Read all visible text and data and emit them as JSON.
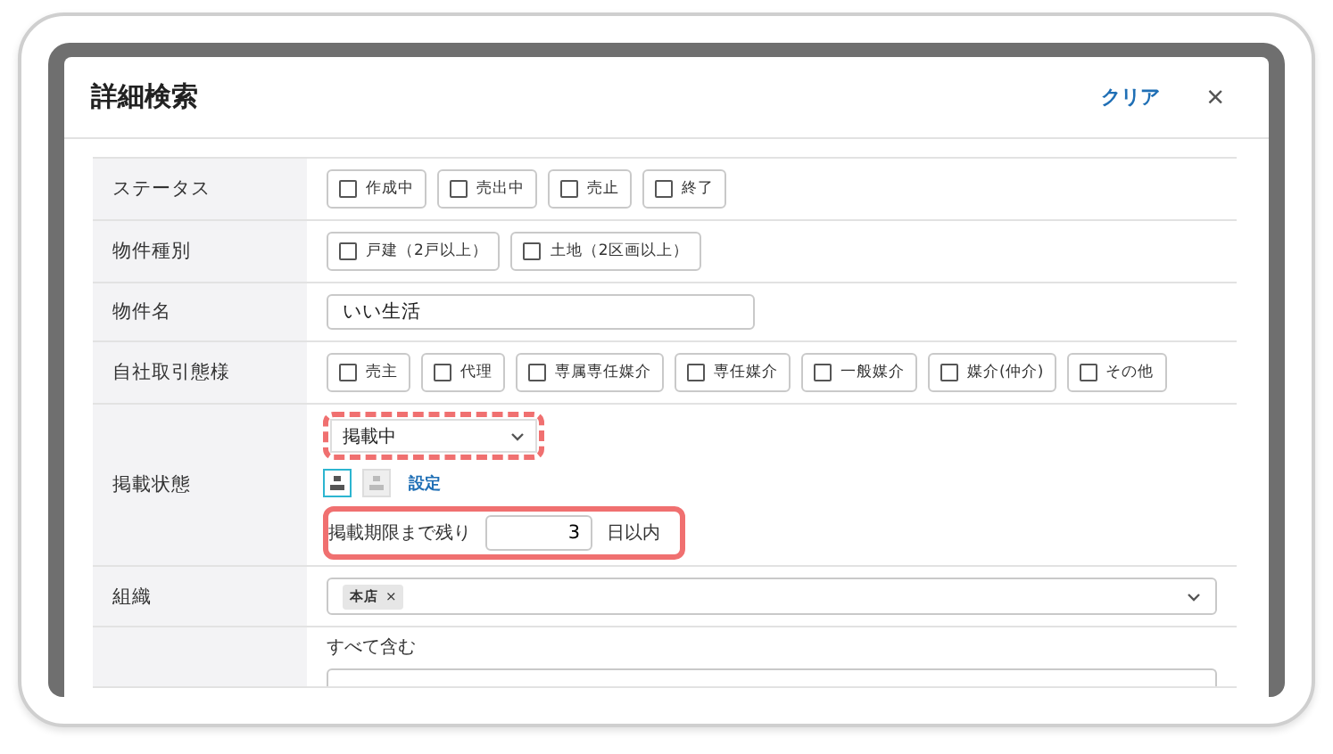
{
  "dialog": {
    "title": "詳細検索",
    "clear_link": "クリア",
    "close": "×"
  },
  "rows": [
    {
      "label": "ステータス",
      "kind": "checks",
      "options": [
        {
          "label": "作成中",
          "checked": false
        },
        {
          "label": "売出中",
          "checked": false
        },
        {
          "label": "売止",
          "checked": false
        },
        {
          "label": "終了",
          "checked": false
        }
      ]
    },
    {
      "label": "物件種別",
      "kind": "checks",
      "options": [
        {
          "label": "戸建（2戸以上）",
          "checked": false
        },
        {
          "label": "土地（2区画以上）",
          "checked": false
        }
      ]
    },
    {
      "label": "物件名",
      "kind": "text",
      "value": "いい生活"
    },
    {
      "label": "自社取引態様",
      "kind": "checks",
      "options": [
        {
          "label": "売主",
          "checked": false
        },
        {
          "label": "代理",
          "checked": false
        },
        {
          "label": "専属専任媒介",
          "checked": false
        },
        {
          "label": "専任媒介",
          "checked": false
        },
        {
          "label": "一般媒介",
          "checked": false
        },
        {
          "label": "媒介(仲介)",
          "checked": false
        },
        {
          "label": "その他",
          "checked": false
        }
      ]
    },
    {
      "label": "掲載状態",
      "kind": "listing",
      "select": "掲載中",
      "toggles": [
        {
          "selected": true
        },
        {
          "selected": false
        }
      ],
      "settings_link": "設定",
      "remaining_label": "掲載期限まで残り",
      "remaining_value": "3",
      "remaining_unit": "日以内"
    },
    {
      "label": "組織",
      "kind": "tags",
      "tags": [
        {
          "label": "本店",
          "remove": "×"
        }
      ]
    },
    {
      "label": "",
      "kind": "contains",
      "caption": "すべて含む"
    }
  ]
}
